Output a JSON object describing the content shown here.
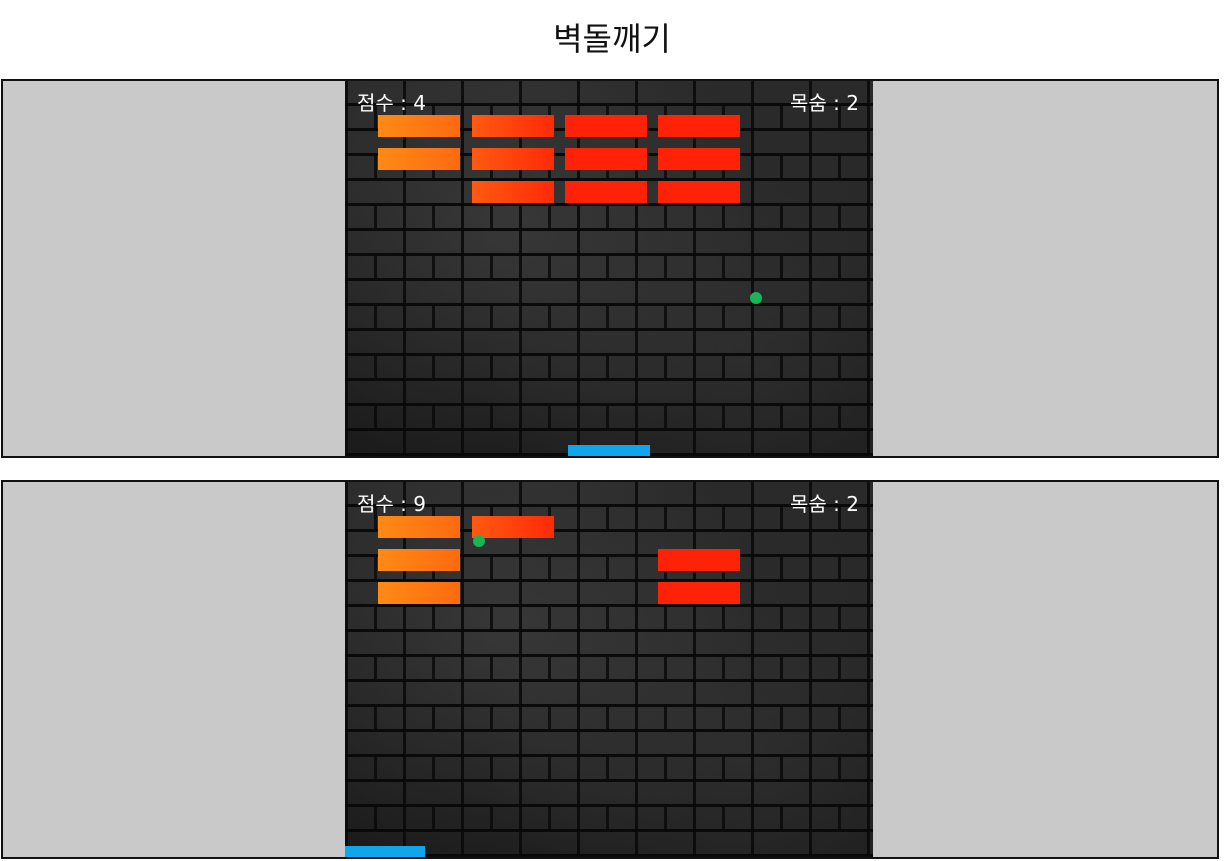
{
  "title": "벽돌깨기",
  "colors": {
    "panel_bg": "#c9c9c9",
    "brick_orange": "#ff8a14",
    "brick_red": "#ff2206",
    "ball": "#19b559",
    "paddle": "#11a6ec"
  },
  "screens": [
    {
      "score_text": "점수 : 4",
      "lives_text": "목숨 : 2",
      "score": 4,
      "lives": 2
    },
    {
      "score_text": "점수 : 9",
      "lives_text": "목숨 : 2",
      "score": 9,
      "lives": 2
    }
  ]
}
